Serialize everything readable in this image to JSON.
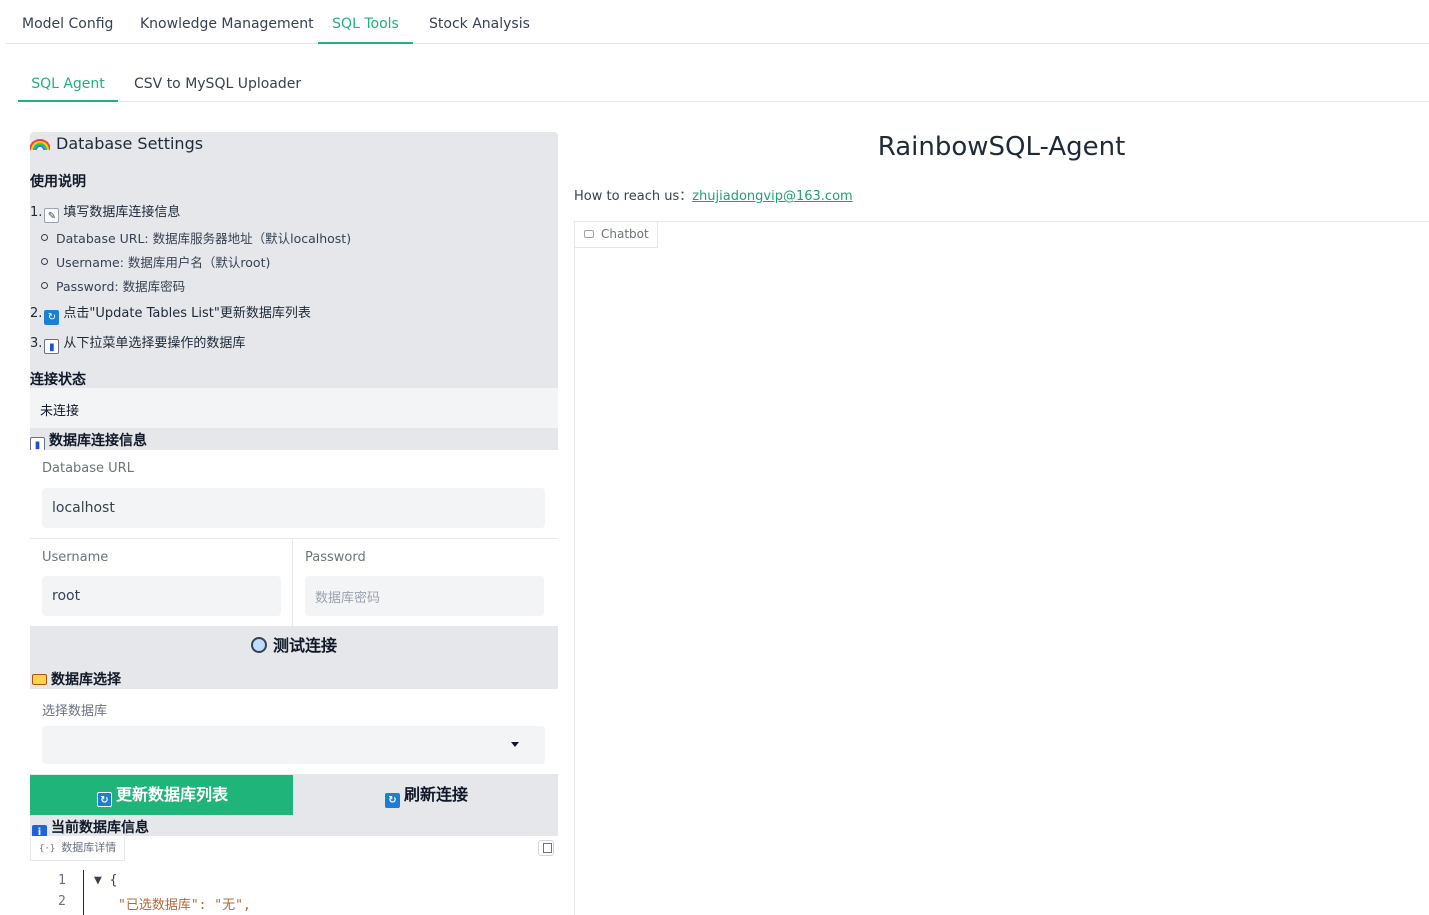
{
  "top_tabs": [
    "Model Config",
    "Knowledge Management",
    "SQL Tools",
    "Stock Analysis"
  ],
  "sub_tabs": [
    "SQL Agent",
    "CSV to MySQL Uploader"
  ],
  "settings": {
    "title": "Database Settings",
    "usage_heading": "使用说明",
    "step1": "1.",
    "step1_text": "填写数据库连接信息",
    "bullets": [
      "Database URL: 数据库服务器地址（默认localhost)",
      "Username: 数据库用户名（默认root)",
      "Password: 数据库密码"
    ],
    "step2": "2.",
    "step2_text": "点击\"Update Tables List\"更新数据库列表",
    "step3": "3.",
    "step3_text": "从下拉菜单选择要操作的数据库",
    "status_heading": "连接状态",
    "status_value": "未连接",
    "conn_heading": "数据库连接信息",
    "url_label": "Database URL",
    "url_value": "localhost",
    "user_label": "Username",
    "user_value": "root",
    "pass_label": "Password",
    "pass_placeholder": "数据库密码",
    "test_button": "测试连接",
    "select_heading": "数据库选择",
    "select_label": "选择数据库",
    "select_value": "",
    "update_button": "更新数据库列表",
    "refresh_button": "刷新连接",
    "info_heading": "当前数据库信息",
    "json_label": "数据库详情",
    "json_lines": [
      "▼ {",
      "\"已选数据库\": \"无\","
    ],
    "line_numbers": [
      "1",
      "2"
    ]
  },
  "main": {
    "title": "RainbowSQL-Agent",
    "reach_label": "How to reach us：",
    "reach_email": "zhujiadongvip@163.com",
    "chatbot_label": "Chatbot"
  },
  "colors": {
    "accent": "#22b07d",
    "update_button_bg": "#1fb57a"
  },
  "icons": [
    "rainbow-icon",
    "memo-icon",
    "refresh-icon",
    "bar-chart-icon",
    "magnifier-icon",
    "folder-icon",
    "info-icon",
    "copy-icon",
    "chat-icon",
    "dropdown-arrow-icon"
  ]
}
